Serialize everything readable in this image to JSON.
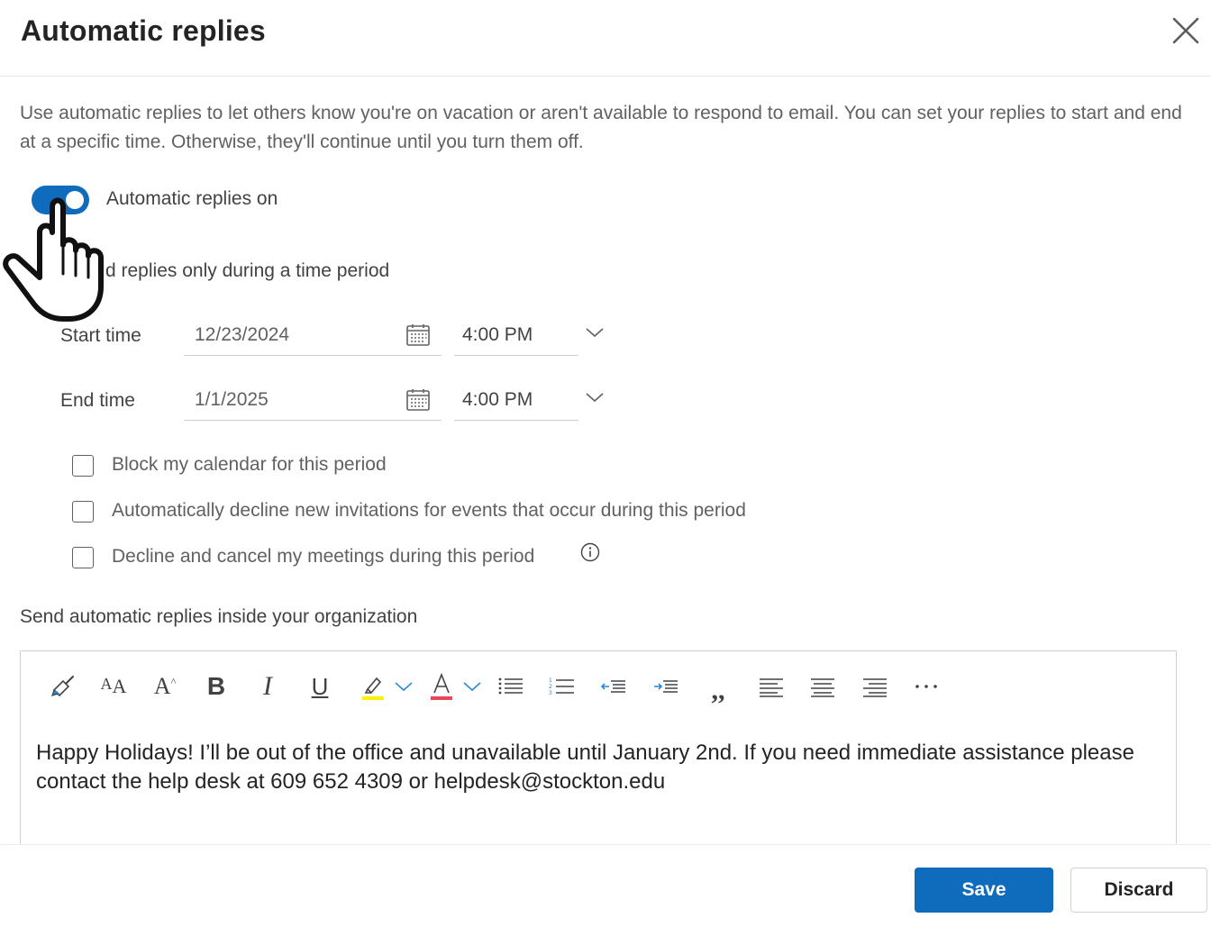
{
  "dialog": {
    "title": "Automatic replies",
    "description": "Use automatic replies to let others know you're on vacation or aren't available to respond to email. You can set your replies to start and end at a specific time. Otherwise, they'll continue until you turn them off."
  },
  "toggle": {
    "label": "Automatic replies on",
    "state": "on",
    "color": "#0f6cbd"
  },
  "time_period": {
    "label_visible": "d replies only during a time period",
    "start": {
      "label": "Start time",
      "date": "12/23/2024",
      "time": "4:00 PM"
    },
    "end": {
      "label": "End time",
      "date": "1/1/2025",
      "time": "4:00 PM"
    }
  },
  "checkboxes": [
    {
      "label": "Block my calendar for this period",
      "checked": false
    },
    {
      "label": "Automatically decline new invitations for events that occur during this period",
      "checked": false
    },
    {
      "label": "Decline and cancel my meetings during this period",
      "checked": false
    }
  ],
  "inside_org": {
    "label": "Send automatic replies inside your organization",
    "message": "Happy Holidays! I’ll be out of the office and unavailable until January 2nd. If you need immediate assistance please contact the help desk at 609 652 4309 or helpdesk@stockton.edu"
  },
  "toolbar": {
    "icons": [
      "format-painter-icon",
      "font-size-icon",
      "grow-font-icon",
      "bold-icon",
      "italic-icon",
      "underline-icon",
      "highlight-icon",
      "font-color-icon",
      "bullets-icon",
      "numbering-icon",
      "decrease-indent-icon",
      "increase-indent-icon",
      "quote-icon",
      "align-left-icon",
      "align-center-icon",
      "align-right-icon",
      "more-icon"
    ],
    "highlight_color": "#fff100",
    "font_color": "#e74856"
  },
  "footer": {
    "save_label": "Save",
    "discard_label": "Discard"
  }
}
